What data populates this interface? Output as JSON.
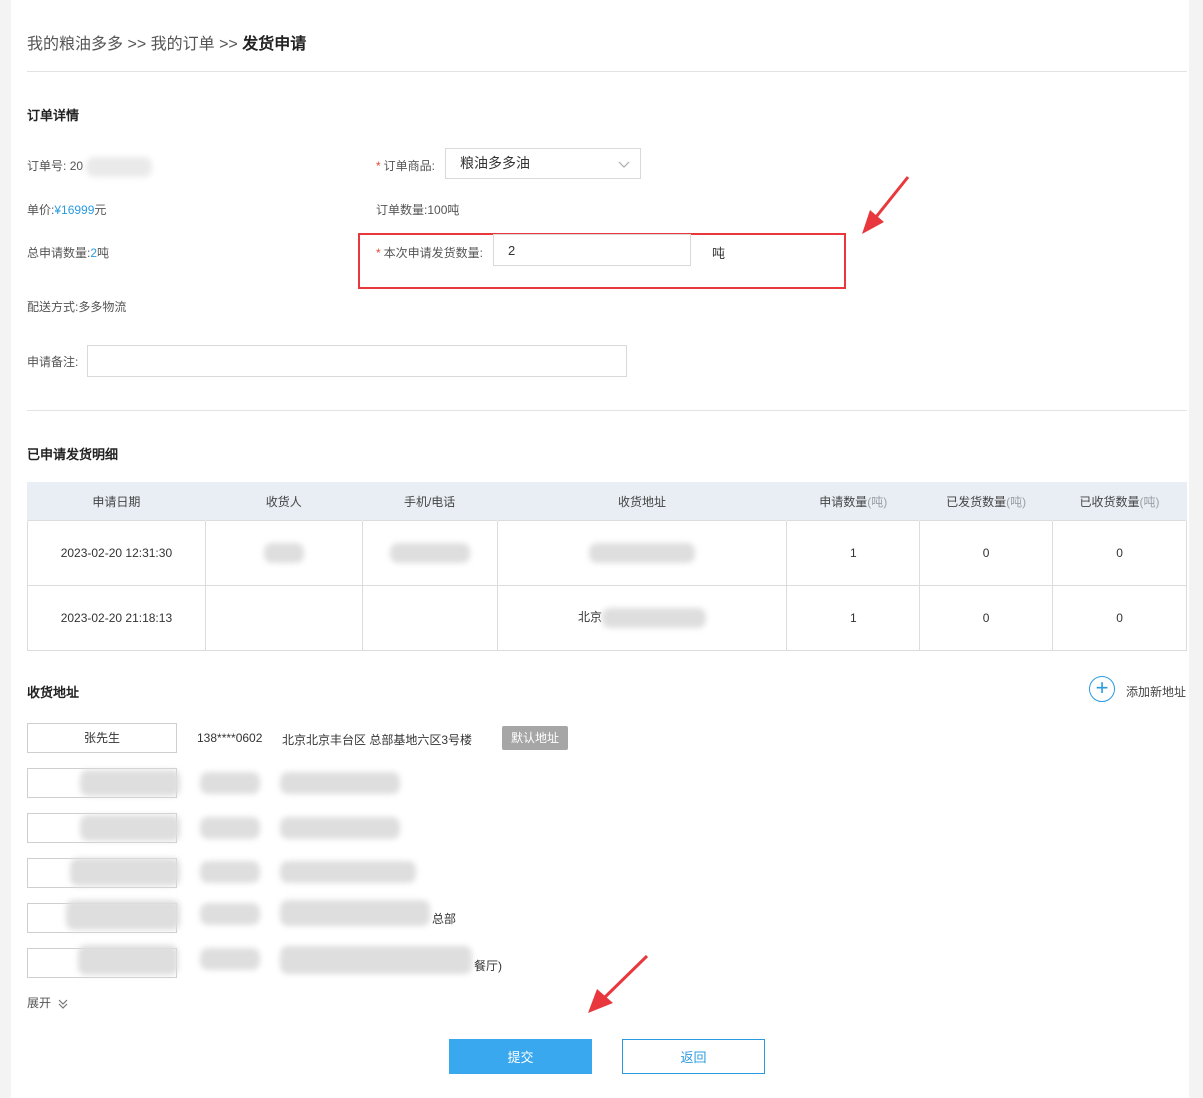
{
  "breadcrumb": {
    "home": "我的粮油多多",
    "sep1": ">>",
    "orders": "我的订单",
    "sep2": ">>",
    "current": "发货申请"
  },
  "order_detail": {
    "section_title": "订单详情",
    "order_no_label": "订单号:",
    "order_no_value": "20",
    "product_label": "订单商品:",
    "product_value": "粮油多多油",
    "price_label": "单价:",
    "price_value": "¥16999",
    "price_unit": "元",
    "order_qty_label": "订单数量:",
    "order_qty_value": "100吨",
    "total_apply_label": "总申请数量:",
    "total_apply_value": "2",
    "total_apply_unit": "吨",
    "this_apply_label": "本次申请发货数量:",
    "this_apply_value": "2",
    "this_apply_unit": "吨",
    "delivery_label": "配送方式:",
    "delivery_value": "多多物流",
    "remark_label": "申请备注:",
    "remark_value": ""
  },
  "shipment_detail": {
    "section_title": "已申请发货明细",
    "columns": [
      {
        "label": "申请日期",
        "unit": ""
      },
      {
        "label": "收货人",
        "unit": ""
      },
      {
        "label": "手机/电话",
        "unit": ""
      },
      {
        "label": "收货地址",
        "unit": ""
      },
      {
        "label": "申请数量",
        "unit": "(吨)"
      },
      {
        "label": "已发货数量",
        "unit": "(吨)"
      },
      {
        "label": "已收货数量",
        "unit": "(吨)"
      }
    ],
    "rows": [
      {
        "date": "2023-02-20 12:31:30",
        "receiver": "",
        "phone": "",
        "address": "",
        "apply_qty": "1",
        "shipped_qty": "0",
        "received_qty": "0"
      },
      {
        "date": "2023-02-20 21:18:13",
        "receiver": "",
        "phone": "",
        "address": "北京",
        "apply_qty": "1",
        "shipped_qty": "0",
        "received_qty": "0"
      }
    ]
  },
  "address_section": {
    "section_title": "收货地址",
    "add_label": "添加新地址",
    "addresses": [
      {
        "name": "张先生",
        "phone": "138****0602",
        "address": "北京北京丰台区 总部基地六区3号楼",
        "badge": "默认地址"
      },
      {
        "name": "",
        "phone": "",
        "address": "",
        "badge": ""
      },
      {
        "name": "",
        "phone": "",
        "address": "",
        "badge": ""
      },
      {
        "name": "",
        "phone": "",
        "address": "",
        "badge": ""
      },
      {
        "name": "",
        "phone": "",
        "address": "总部",
        "badge": ""
      },
      {
        "name": "",
        "phone": "",
        "address": "餐厅)",
        "badge": ""
      }
    ],
    "expand_label": "展开"
  },
  "actions": {
    "submit_label": "提交",
    "back_label": "返回"
  },
  "colors": {
    "accent": "#2a9be2",
    "submit_bg": "#3aa8ee",
    "highlight": "#e9383d",
    "required": "#e24a3b"
  }
}
